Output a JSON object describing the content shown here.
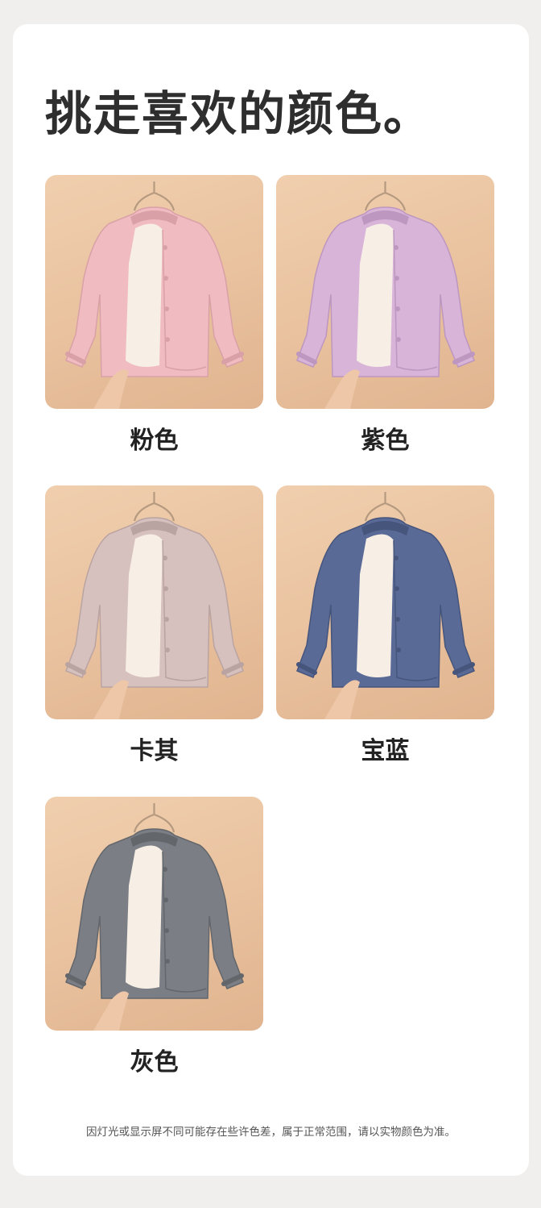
{
  "page": {
    "title": "挑走喜欢的颜色。",
    "disclaimer": "因灯光或显示屏不同可能存在些许色差，属于正常范围，请以实物颜色为准。"
  },
  "swatches": [
    {
      "label": "粉色",
      "color": "#f0bcc1",
      "shade": "#d9a1a7",
      "image_icon": "pink-jacket-image"
    },
    {
      "label": "紫色",
      "color": "#d8b4d9",
      "shade": "#bd97bf",
      "image_icon": "purple-jacket-image"
    },
    {
      "label": "卡其",
      "color": "#d6c1bf",
      "shade": "#baa4a2",
      "image_icon": "khaki-jacket-image"
    },
    {
      "label": "宝蓝",
      "color": "#5a6a96",
      "shade": "#46557c",
      "image_icon": "royal-blue-jacket-image"
    },
    {
      "label": "灰色",
      "color": "#7b7f85",
      "shade": "#63676c",
      "image_icon": "gray-jacket-image"
    }
  ]
}
